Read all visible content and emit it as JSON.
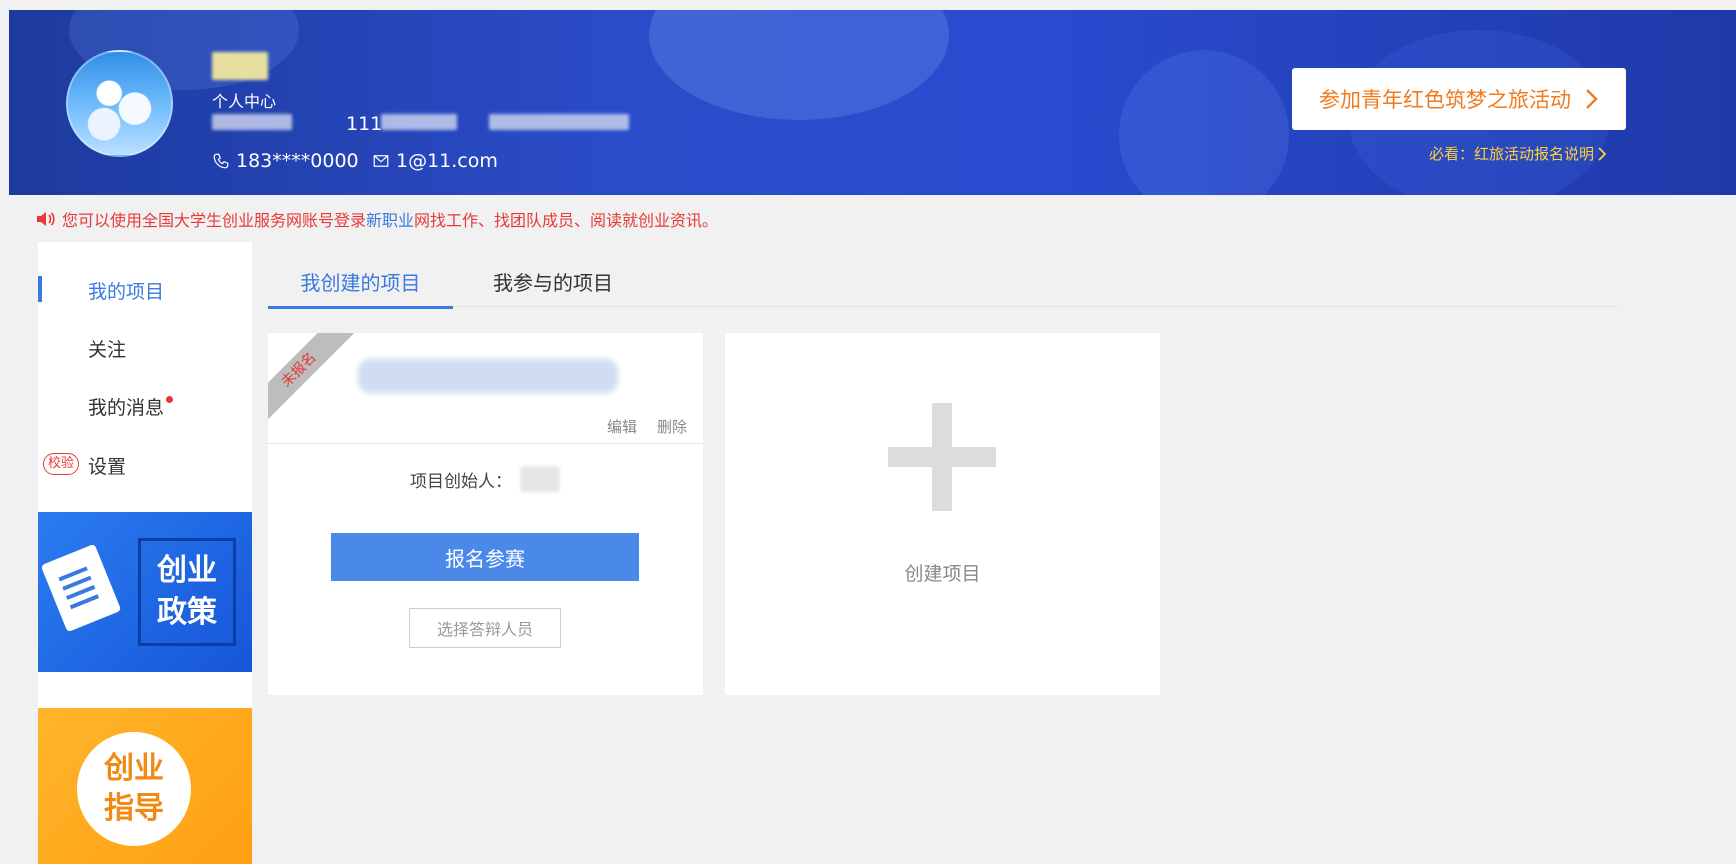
{
  "header": {
    "personal_center": "个人中心",
    "number": "111",
    "phone": "183****0000",
    "email": "1@11.com",
    "activity_button": "参加青年红色筑梦之旅活动",
    "must_read": "必看：红旅活动报名说明"
  },
  "notice": {
    "prefix": "您可以使用全国大学生创业服务网账号登录",
    "link": "新职业",
    "suffix": "网找工作、找团队成员、阅读就创业资讯。"
  },
  "sidebar": {
    "items": [
      {
        "label": "我的项目",
        "active": true
      },
      {
        "label": "关注"
      },
      {
        "label": "我的消息",
        "has_dot": true
      },
      {
        "label": "设置"
      }
    ],
    "verify_badge": "校验",
    "promo_policy": {
      "line1": "创业",
      "line2": "政策"
    },
    "promo_guide": {
      "line1": "创业",
      "line2": "指导"
    }
  },
  "tabs": [
    "我创建的项目",
    "我参与的项目"
  ],
  "project_card": {
    "status_ribbon": "未报名",
    "edit": "编辑",
    "delete": "删除",
    "creator_label": "项目创始人：",
    "register_button": "报名参赛",
    "select_defense_button": "选择答辩人员"
  },
  "create_card": {
    "label": "创建项目"
  },
  "colors": {
    "primary_blue": "#3a7ae0",
    "header_blue": "#2b4cc8",
    "accent_orange": "#f07a1e",
    "notice_red": "#e63a3a",
    "must_read_yellow": "#ffd23a"
  }
}
